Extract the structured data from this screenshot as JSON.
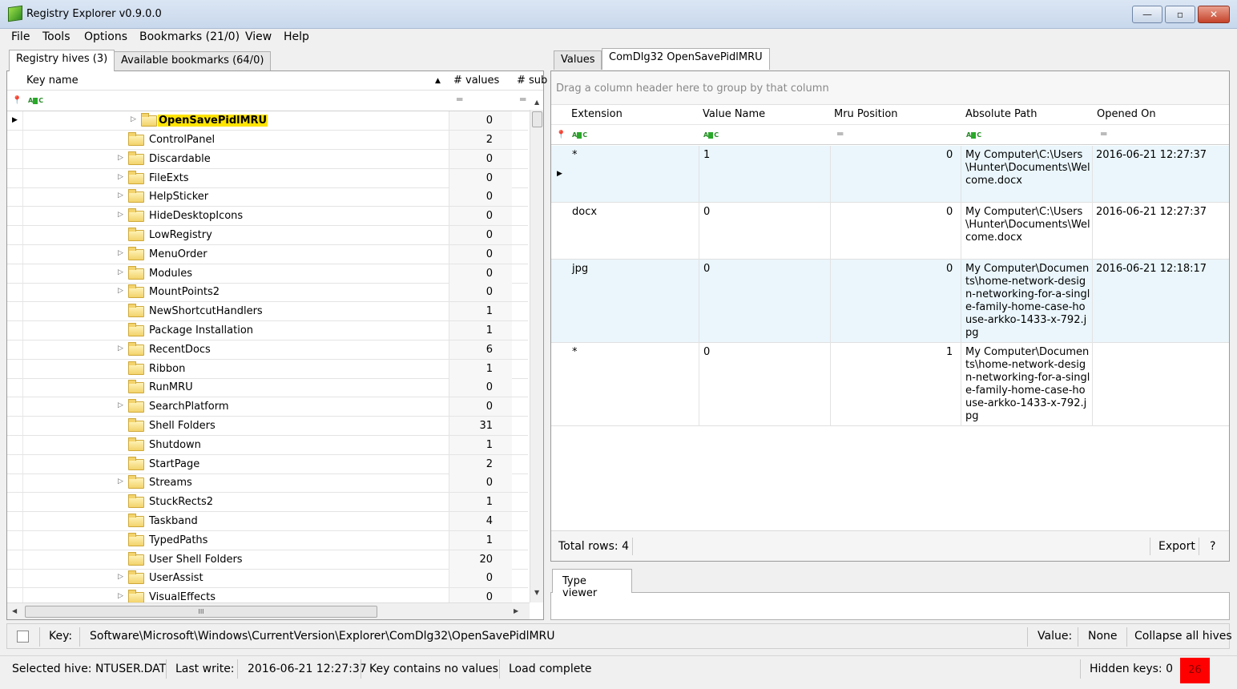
{
  "window": {
    "title": "Registry Explorer v0.9.0.0",
    "min": "—",
    "max": "▫",
    "close": "✕"
  },
  "menu": [
    "File",
    "Tools",
    "Options",
    "Bookmarks (21/0)",
    "View",
    "Help"
  ],
  "left_tabs": [
    "Registry hives (3)",
    "Available bookmarks (64/0)"
  ],
  "tree": {
    "headers": {
      "key_name": "Key name",
      "values": "# values",
      "subkeys": "# sub"
    },
    "selected": {
      "label": "OpenSavePidlMRU",
      "count": "0"
    },
    "rows": [
      {
        "label": "ControlPanel",
        "count": "2",
        "expandable": false
      },
      {
        "label": "Discardable",
        "count": "0",
        "expandable": true
      },
      {
        "label": "FileExts",
        "count": "0",
        "expandable": true
      },
      {
        "label": "HelpSticker",
        "count": "0",
        "expandable": true
      },
      {
        "label": "HideDesktopIcons",
        "count": "0",
        "expandable": true
      },
      {
        "label": "LowRegistry",
        "count": "0",
        "expandable": false
      },
      {
        "label": "MenuOrder",
        "count": "0",
        "expandable": true
      },
      {
        "label": "Modules",
        "count": "0",
        "expandable": true
      },
      {
        "label": "MountPoints2",
        "count": "0",
        "expandable": true
      },
      {
        "label": "NewShortcutHandlers",
        "count": "1",
        "expandable": false
      },
      {
        "label": "Package Installation",
        "count": "1",
        "expandable": false
      },
      {
        "label": "RecentDocs",
        "count": "6",
        "expandable": true
      },
      {
        "label": "Ribbon",
        "count": "1",
        "expandable": false
      },
      {
        "label": "RunMRU",
        "count": "0",
        "expandable": false
      },
      {
        "label": "SearchPlatform",
        "count": "0",
        "expandable": true
      },
      {
        "label": "Shell Folders",
        "count": "31",
        "expandable": false
      },
      {
        "label": "Shutdown",
        "count": "1",
        "expandable": false
      },
      {
        "label": "StartPage",
        "count": "2",
        "expandable": false
      },
      {
        "label": "Streams",
        "count": "0",
        "expandable": true
      },
      {
        "label": "StuckRects2",
        "count": "1",
        "expandable": false
      },
      {
        "label": "Taskband",
        "count": "4",
        "expandable": false
      },
      {
        "label": "TypedPaths",
        "count": "1",
        "expandable": false
      },
      {
        "label": "User Shell Folders",
        "count": "20",
        "expandable": false
      },
      {
        "label": "UserAssist",
        "count": "0",
        "expandable": true
      },
      {
        "label": "VisualEffects",
        "count": "0",
        "expandable": true
      }
    ]
  },
  "right_tabs": [
    "Values",
    "ComDlg32 OpenSavePidlMRU"
  ],
  "values": {
    "group_hint": "Drag a column header here to group by that column",
    "headers": [
      "Extension",
      "Value Name",
      "Mru Position",
      "Absolute Path",
      "Opened On"
    ],
    "rows": [
      {
        "extension": "*",
        "value_name": "1",
        "mru": "0",
        "path": "My Computer\\C:\\Users\\Hunter\\Documents\\Welcome.docx",
        "opened": "2016-06-21 12:27:37"
      },
      {
        "extension": "docx",
        "value_name": "0",
        "mru": "0",
        "path": "My Computer\\C:\\Users\\Hunter\\Documents\\Welcome.docx",
        "opened": "2016-06-21 12:27:37"
      },
      {
        "extension": "jpg",
        "value_name": "0",
        "mru": "0",
        "path": "My Computer\\Documents\\home-network-design-networking-for-a-single-family-home-case-house-arkko-1433-x-792.jpg",
        "opened": "2016-06-21 12:18:17"
      },
      {
        "extension": "*",
        "value_name": "0",
        "mru": "1",
        "path": "My Computer\\Documents\\home-network-design-networking-for-a-single-family-home-case-house-arkko-1433-x-792.jpg",
        "opened": ""
      }
    ],
    "total_rows": "Total rows: 4",
    "export": "Export",
    "help": "?"
  },
  "type_viewer": "Type viewer",
  "keybar": {
    "key_label": "Key:",
    "key_path": "Software\\Microsoft\\Windows\\CurrentVersion\\Explorer\\ComDlg32\\OpenSavePidlMRU",
    "value_label": "Value:",
    "value": "None",
    "collapse": "Collapse all hives"
  },
  "status": {
    "selected_hive": "Selected hive: NTUSER.DAT",
    "last_write_label": "Last write:",
    "last_write": "2016-06-21 12:27:37",
    "key_values": "Key contains no values",
    "load": "Load complete",
    "hidden_keys": "Hidden keys: 0",
    "badge": "26"
  }
}
